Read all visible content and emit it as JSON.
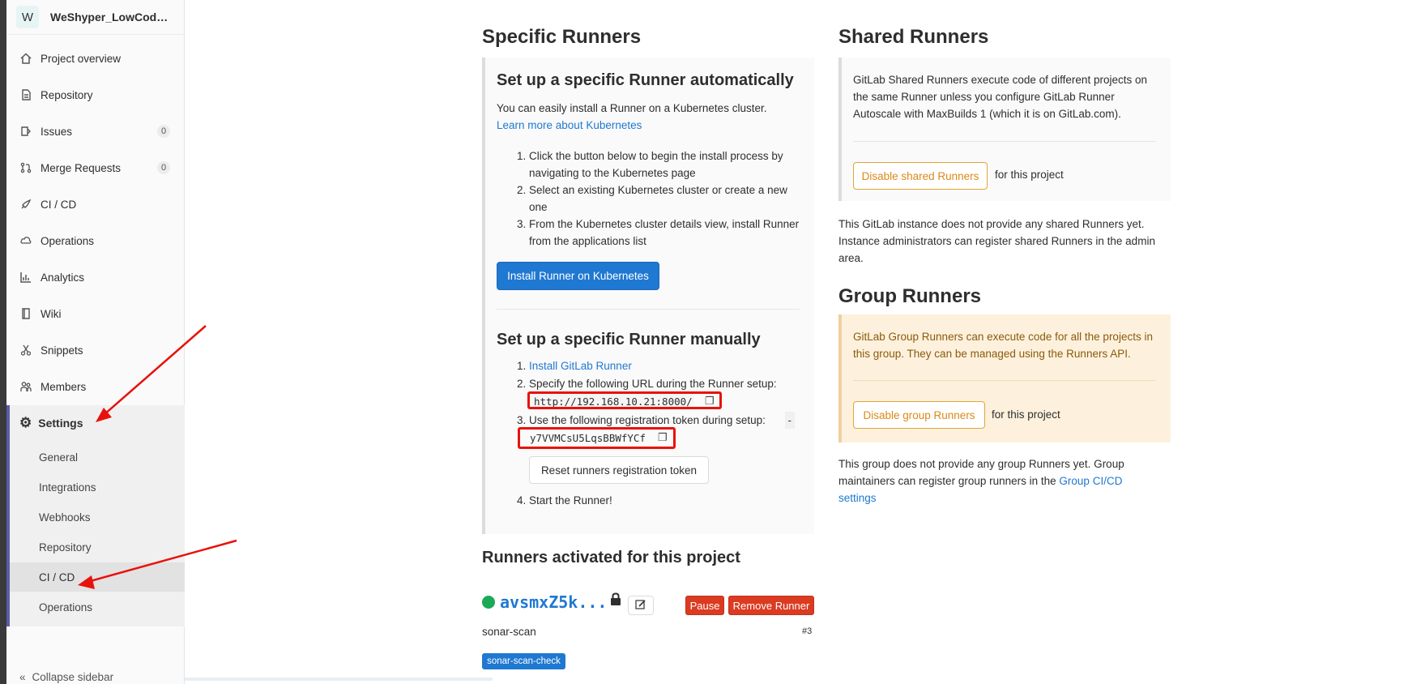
{
  "sidebar": {
    "project_initial": "W",
    "project_name": "WeShyper_LowCode...",
    "items": [
      {
        "label": "Project overview",
        "icon": "home-icon"
      },
      {
        "label": "Repository",
        "icon": "file-icon"
      },
      {
        "label": "Issues",
        "icon": "issues-icon",
        "badge": "0"
      },
      {
        "label": "Merge Requests",
        "icon": "merge-request-icon",
        "badge": "0"
      },
      {
        "label": "CI / CD",
        "icon": "rocket-icon"
      },
      {
        "label": "Operations",
        "icon": "cloud-gear-icon"
      },
      {
        "label": "Analytics",
        "icon": "chart-icon"
      },
      {
        "label": "Wiki",
        "icon": "book-icon"
      },
      {
        "label": "Snippets",
        "icon": "scissors-icon"
      },
      {
        "label": "Members",
        "icon": "users-icon"
      }
    ],
    "settings": {
      "label": "Settings",
      "icon": "gear-icon",
      "subitems": [
        "General",
        "Integrations",
        "Webhooks",
        "Repository",
        "CI / CD",
        "Operations"
      ],
      "active_subitem": "CI / CD"
    },
    "collapse_label": "Collapse sidebar"
  },
  "specific": {
    "title": "Specific Runners",
    "auto": {
      "title": "Set up a specific Runner automatically",
      "intro": "You can easily install a Runner on a Kubernetes cluster.",
      "learn_link": "Learn more about Kubernetes",
      "steps": [
        "Click the button below to begin the install process by navigating to the Kubernetes page",
        "Select an existing Kubernetes cluster or create a new one",
        "From the Kubernetes cluster details view, install Runner from the applications list"
      ],
      "install_button": "Install Runner on Kubernetes"
    },
    "manual": {
      "title": "Set up a specific Runner manually",
      "step1_link": "Install GitLab Runner",
      "step2": "Specify the following URL during the Runner setup:",
      "url": "http://192.168.10.21:8000/",
      "step3": "Use the following registration token during setup:",
      "token_dash": "-",
      "token": "y7VVMCsU5LqsBBWfYCf",
      "reset_button": "Reset runners registration token",
      "step4": "Start the Runner!"
    },
    "activated": {
      "title": "Runners activated for this project",
      "runner_name": "avsmxZ5k...",
      "pause": "Pause",
      "remove": "Remove Runner",
      "description": "sonar-scan",
      "id": "#3",
      "tag": "sonar-scan-check"
    }
  },
  "shared": {
    "title": "Shared Runners",
    "info": "GitLab Shared Runners execute code of different projects on the same Runner unless you configure GitLab Runner Autoscale with MaxBuilds 1 (which it is on GitLab.com).",
    "disable_button": "Disable shared Runners",
    "for_project": "for this project",
    "note": "This GitLab instance does not provide any shared Runners yet. Instance administrators can register shared Runners in the admin area."
  },
  "group": {
    "title": "Group Runners",
    "info": "GitLab Group Runners can execute code for all the projects in this group. They can be managed using the Runners API.",
    "disable_button": "Disable group Runners",
    "for_project": "for this project",
    "note_prefix": "This group does not provide any group Runners yet. Group maintainers can register group runners in the",
    "note_link": "Group CI/CD settings"
  }
}
